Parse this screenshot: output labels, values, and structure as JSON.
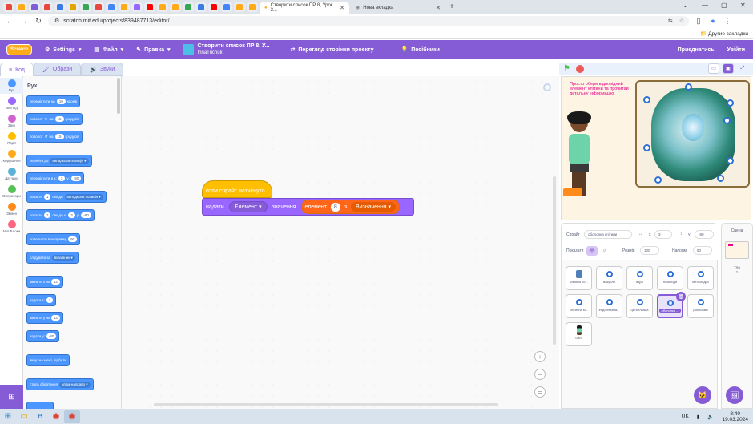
{
  "browser": {
    "active_tab_title": "Створити список ПР 8, Урок 3...",
    "other_tab_title": "Нова вкладка",
    "url": "scratch.mit.edu/projects/839487713/editor/",
    "bookmarks_other": "Другие закладки"
  },
  "menu": {
    "logo": "Scratch",
    "settings": "Settings",
    "file": "Файл",
    "edit": "Правка",
    "project_title": "Створити список ПР 8, У...",
    "author": "InnaTrichuk",
    "see_project": "Перегляд сторінки проєкту",
    "tutorials": "Посібники",
    "share": "Приєднатись",
    "signin": "Увійти"
  },
  "editor_tabs": {
    "code": "Код",
    "costumes": "Образи",
    "sounds": "Звуки"
  },
  "categories": [
    {
      "label": "Рух",
      "color": "#4c97ff"
    },
    {
      "label": "Вигляд",
      "color": "#9966ff"
    },
    {
      "label": "Звук",
      "color": "#cf63cf"
    },
    {
      "label": "Події",
      "color": "#ffbf00"
    },
    {
      "label": "Керування",
      "color": "#ffab19"
    },
    {
      "label": "Датчики",
      "color": "#5cb1d6"
    },
    {
      "label": "Оператори",
      "color": "#59c059"
    },
    {
      "label": "Змінні",
      "color": "#ff8c1a"
    },
    {
      "label": "Мої Блоки",
      "color": "#ff6680"
    }
  ],
  "palette": {
    "title": "Рух",
    "b1": {
      "pre": "перемістити на",
      "val": "10",
      "post": "кроків"
    },
    "b2": {
      "pre": "поворот",
      "mid": "на",
      "val": "15",
      "post": "градусів"
    },
    "b3": {
      "pre": "поворот",
      "mid": "на",
      "val": "15",
      "post": "градусів"
    },
    "b4": {
      "pre": "перейти до",
      "dd": "випадкова позиція"
    },
    "b5": {
      "pre": "перемістити в x:",
      "x": "3",
      "ylbl": "y:",
      "y": "-80"
    },
    "b6": {
      "pre": "ковзати",
      "val": "1",
      "mid": "сек до",
      "dd": "випадкова позиція"
    },
    "b7": {
      "pre": "ковзати",
      "val": "1",
      "mid": "сек до x:",
      "x": "3",
      "ylbl": "y:",
      "y": "-80"
    },
    "b8": {
      "pre": "повернути в напрямку",
      "val": "90"
    },
    "b9": {
      "pre": "слідувати за",
      "dd": "вказівник"
    },
    "b10": {
      "pre": "змінити x на",
      "val": "10"
    },
    "b11": {
      "pre": "задати x:",
      "val": "3"
    },
    "b12": {
      "pre": "змінити у на",
      "val": "10"
    },
    "b13": {
      "pre": "задати у:",
      "val": "-80"
    },
    "b14": {
      "pre": "якщо на межі, відбити"
    },
    "b15": {
      "pre": "стиль обертання",
      "dd": "зліва-направо"
    }
  },
  "script": {
    "hat": "коли спрайт натиснуто",
    "say_label": "надати",
    "var_dd": "Елемент",
    "value_label": "значення",
    "item_label": "елемент",
    "item_index": "8",
    "of_label": "з",
    "list_dd": "Визначення"
  },
  "stage": {
    "text": "Просто обери відповідний елемент клітини та прочитай детальну інформацію"
  },
  "sprite_info": {
    "sprite_label": "Спрайт",
    "sprite_name": "оболонка клітини",
    "x_label": "x",
    "x": "3",
    "y_label": "y",
    "y": "-80",
    "show_label": "Показати",
    "size_label": "Розмір",
    "size": "100",
    "direction_label": "Напрям",
    "direction": "90"
  },
  "sprites": [
    {
      "name": "клітина ро..."
    },
    {
      "name": "вакуоля"
    },
    {
      "name": "ядро"
    },
    {
      "name": "пластиди"
    },
    {
      "name": "мітохондрії"
    },
    {
      "name": "клітинна м..."
    },
    {
      "name": "ендоплазма..."
    },
    {
      "name": "цитоплазма"
    },
    {
      "name": "оболонка ..."
    },
    {
      "name": "рибосоми"
    },
    {
      "name": "Dani"
    }
  ],
  "stage_pane": {
    "title": "Сцена",
    "backdrops_label": "Тло",
    "backdrops_count": "1"
  },
  "taskbar": {
    "lang": "UK",
    "time": "8:40",
    "date": "19.03.2024"
  }
}
